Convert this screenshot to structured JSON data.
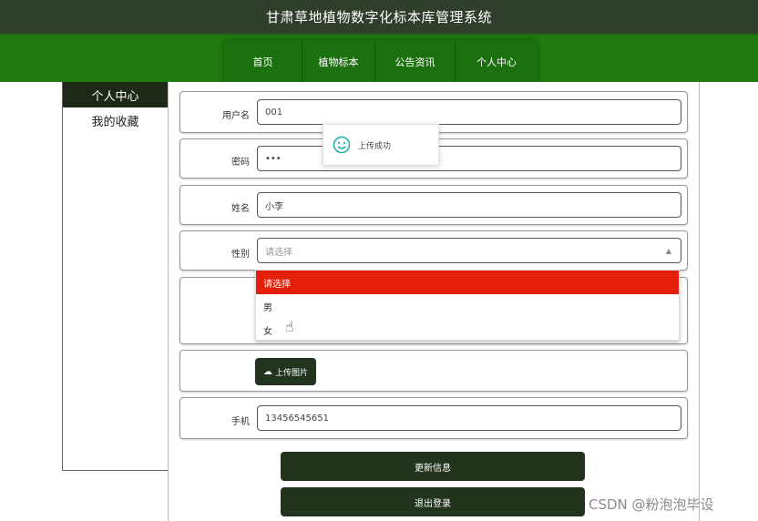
{
  "header": {
    "title": "甘肃草地植物数字化标本库管理系统"
  },
  "nav": {
    "home": "首页",
    "plants": "植物标本",
    "notices": "公告资讯",
    "user_center": "个人中心"
  },
  "sidebar": {
    "items": [
      {
        "label": "个人中心",
        "active": true
      },
      {
        "label": "我的收藏",
        "active": false
      }
    ]
  },
  "form": {
    "username": {
      "label": "用户名",
      "value": "001"
    },
    "password": {
      "label": "密码",
      "value": "•••"
    },
    "name": {
      "label": "姓名",
      "value": "小李"
    },
    "gender": {
      "label": "性别",
      "placeholder": "请选择",
      "options": [
        "请选择",
        "男",
        "女"
      ],
      "highlighted_option": "请选择"
    },
    "upload_label": "上传图片",
    "phone": {
      "label": "手机",
      "value": "13456545651"
    }
  },
  "buttons": {
    "update": "更新信息",
    "logout": "退出登录"
  },
  "toast": {
    "message": "上传成功",
    "icon": "smile-icon",
    "color": "#22b3a8"
  },
  "watermark": "CSDN @粉泡泡毕设",
  "colors": {
    "header_bg": "#2f3f2b",
    "nav_bg": "#1f7a0f",
    "button_bg": "#22331e",
    "highlight_option": "#e31f0b"
  }
}
